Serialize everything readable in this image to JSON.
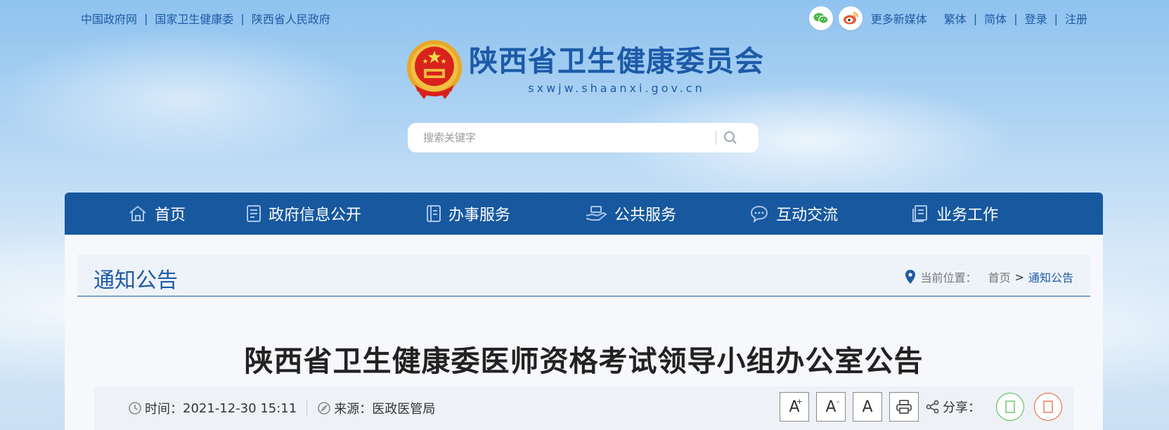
{
  "top_links": [
    "中国政府网",
    "国家卫生健康委",
    "陕西省人民政府"
  ],
  "top_right": {
    "more_media": "更多新媒体",
    "links": [
      "繁体",
      "简体",
      "登录",
      "注册"
    ]
  },
  "logo": {
    "title": "陕西省卫生健康委员会",
    "url": "sxwjw.shaanxi.gov.cn"
  },
  "search": {
    "placeholder": "搜索关键字"
  },
  "nav": [
    {
      "label": "首页",
      "icon": "home-icon"
    },
    {
      "label": "政府信息公开",
      "icon": "document-icon"
    },
    {
      "label": "办事服务",
      "icon": "handbook-icon"
    },
    {
      "label": "公共服务",
      "icon": "hand-service-icon"
    },
    {
      "label": "互动交流",
      "icon": "chat-icon"
    },
    {
      "label": "业务工作",
      "icon": "work-icon"
    }
  ],
  "category": {
    "title": "通知公告",
    "breadcrumb_prefix": "当前位置：",
    "breadcrumb_home": "首页",
    "breadcrumb_sep": ">",
    "breadcrumb_current": "通知公告"
  },
  "article": {
    "title": "陕西省卫生健康委医师资格考试领导小组办公室公告",
    "time_label": "时间：",
    "time_value": "2021-12-30 15:11",
    "source_label": "来源：",
    "source_value": "医政医管局",
    "font_large": "A",
    "font_large_sup": "+",
    "font_small": "A",
    "font_small_sup": "-",
    "font_default": "A",
    "share_label": "分享："
  },
  "colors": {
    "brand_blue": "#17589f",
    "link_blue": "#1f5aa5",
    "wechat_green": "#4cb84a",
    "weibo_red": "#e45d3a"
  }
}
